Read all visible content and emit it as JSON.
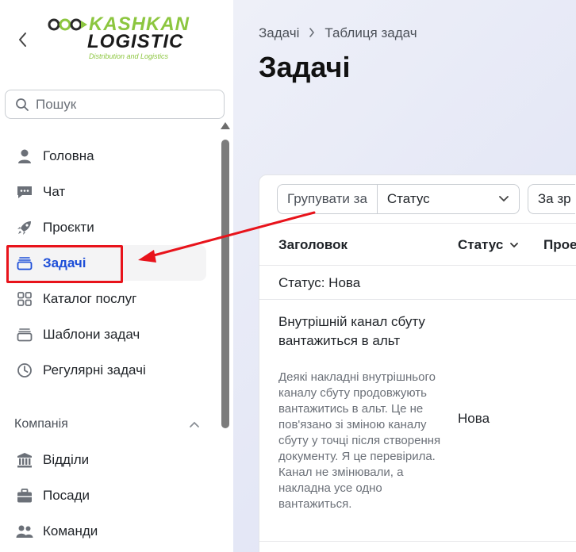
{
  "logo": {
    "line1": "KASHKAN",
    "line2": "LOGISTIC",
    "tagline": "Distribution and Logistics"
  },
  "search": {
    "placeholder": "Пошук"
  },
  "nav": [
    {
      "label": "Головна",
      "icon": "user-icon"
    },
    {
      "label": "Чат",
      "icon": "chat-icon"
    },
    {
      "label": "Проєкти",
      "icon": "rocket-icon"
    },
    {
      "label": "Задачі",
      "icon": "tasks-icon",
      "active": true
    },
    {
      "label": "Каталог послуг",
      "icon": "grid-icon"
    },
    {
      "label": "Шаблони задач",
      "icon": "templates-icon"
    },
    {
      "label": "Регулярні задачі",
      "icon": "clock-icon"
    }
  ],
  "company": {
    "label": "Компанія",
    "items": [
      {
        "label": "Відділи",
        "icon": "bank-icon"
      },
      {
        "label": "Посади",
        "icon": "briefcase-icon"
      },
      {
        "label": "Команди",
        "icon": "team-icon"
      }
    ]
  },
  "breadcrumb": {
    "first": "Задачі",
    "second": "Таблиця задач"
  },
  "page": {
    "title": "Задачі"
  },
  "toolbar": {
    "group_label": "Групувати за",
    "group_value": "Статус",
    "sort_value": "За зр"
  },
  "table": {
    "columns": [
      "Заголовок",
      "Статус",
      "Прое"
    ],
    "group_title": "Статус: Нова",
    "rows": [
      {
        "title": "Внутрішній канал сбуту вантажиться в альт",
        "description": "Деякі накладні внутрішнього каналу сбуту продовжують вантажитись в альт. Це не пов'язано зі зміною каналу сбуту у точці після створення документу. Я це перевірила. Канал не змінювали, а накладна усе одно вантажиться.",
        "status": "Нова"
      }
    ]
  },
  "colors": {
    "accent": "#1d4ed8",
    "highlight": "#e8131b",
    "logo_green": "#8cc63f"
  }
}
